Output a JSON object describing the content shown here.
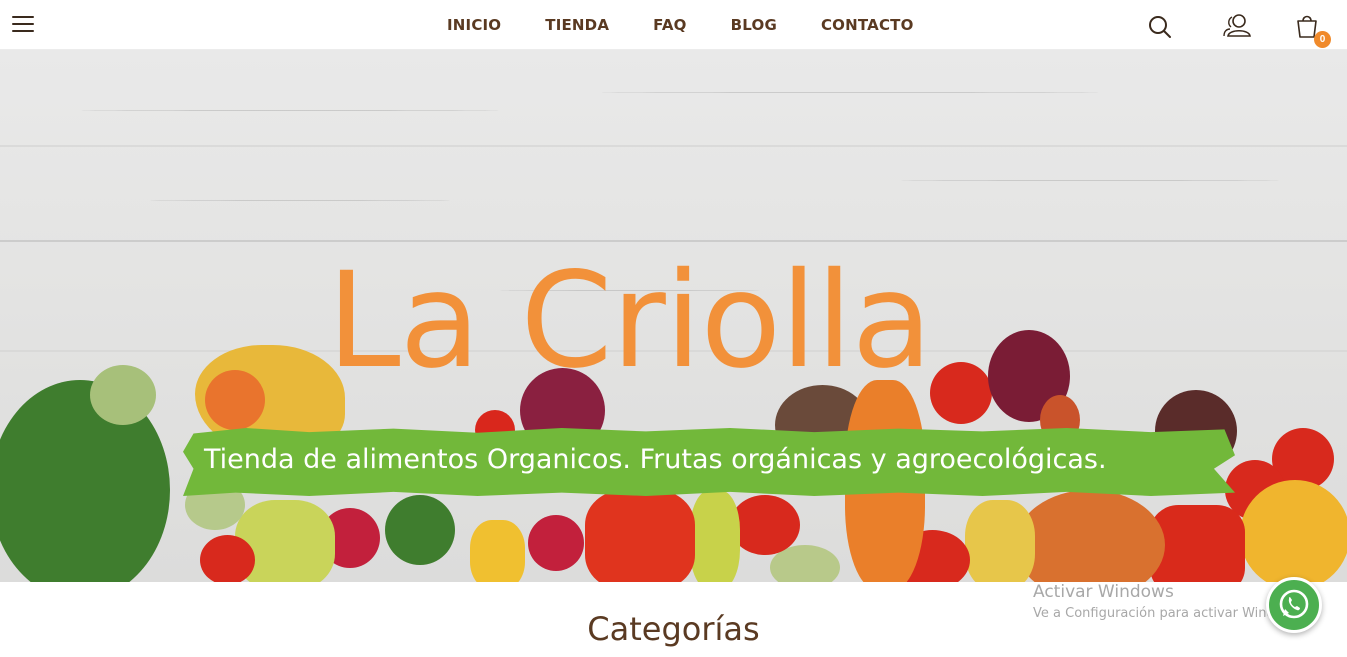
{
  "header": {
    "menu_icon": "hamburger-menu-icon",
    "nav": [
      {
        "label": "INICIO"
      },
      {
        "label": "TIENDA"
      },
      {
        "label": "FAQ"
      },
      {
        "label": "BLOG"
      },
      {
        "label": "CONTACTO"
      }
    ],
    "icons": [
      "search-icon",
      "user-icon",
      "shopping-bag-icon"
    ],
    "cart_count": "0"
  },
  "hero": {
    "title": "La Criolla",
    "tagline": "Tienda de alimentos Organicos. Frutas orgánicas y agroecológicas."
  },
  "section": {
    "heading": "Categorías"
  },
  "overlay": {
    "windows_title": "Activar Windows",
    "windows_subtitle": "Ve a Configuración para activar Windows."
  },
  "floating": {
    "whatsapp_icon": "whatsapp-icon"
  },
  "colors": {
    "accent_orange": "#f2913a",
    "banner_green": "#72b83a",
    "text_brown": "#5a3a22",
    "whatsapp_green": "#4caf50"
  }
}
